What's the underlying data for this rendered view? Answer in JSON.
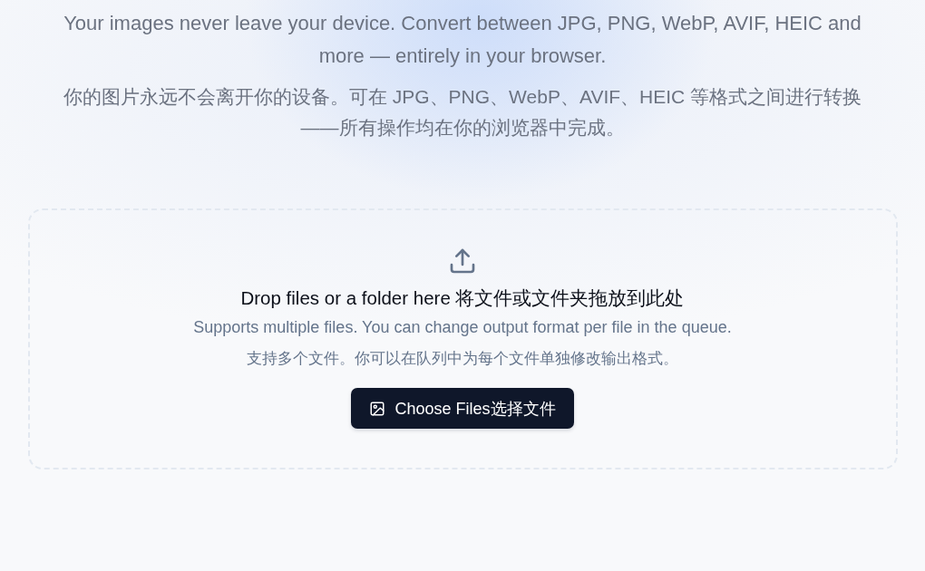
{
  "intro": [
    "Your images never leave your device. Convert between JPG, PNG, WebP, AVIF, HEIC and more — entirely in your browser.",
    "你的图片永远不会离开你的设备。可在 JPG、PNG、WebP、AVIF、HEIC 等格式之间进行转换——所有操作均在你的浏览器中完成。"
  ],
  "dropzone": {
    "title": "Drop files or a folder here 将文件或文件夹拖放到此处",
    "hints": [
      "Supports multiple files. You can change output format per file in the queue.",
      "支持多个文件。你可以在队列中为每个文件单独修改输出格式。"
    ],
    "button": "Choose Files选择文件"
  }
}
